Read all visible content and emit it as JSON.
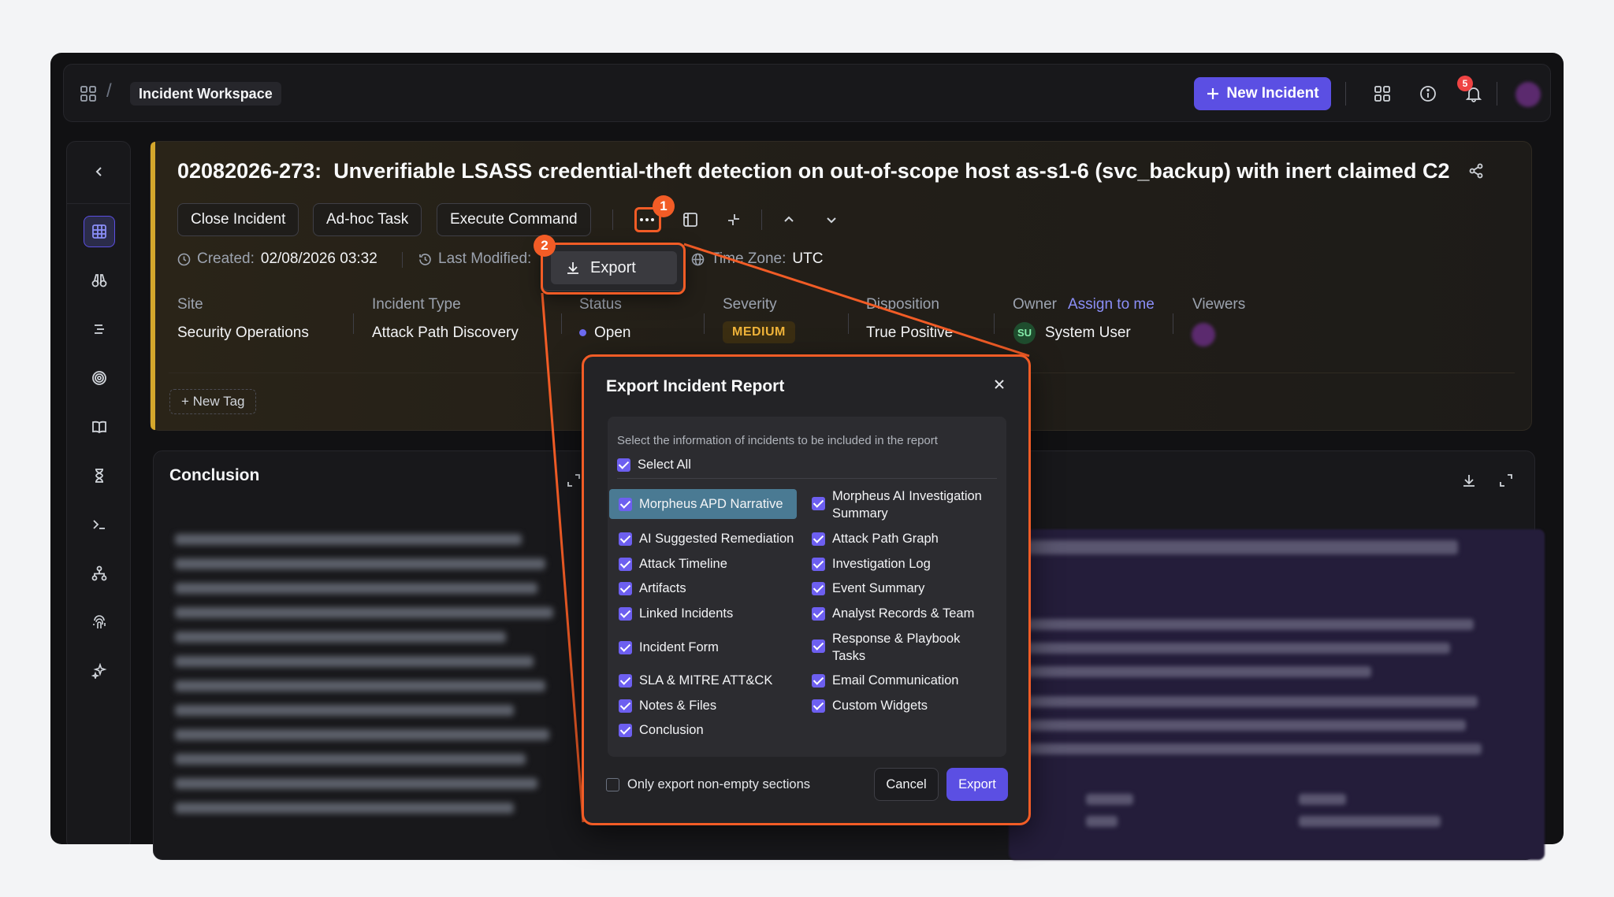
{
  "topbar": {
    "breadcrumb": "Incident Workspace",
    "new_incident_label": "New Incident",
    "notification_count": "5"
  },
  "incident": {
    "id": "02082026-273:",
    "title": "Unverifiable LSASS credential-theft detection on out-of-scope host as-s1-6 (svc_backup) with inert claimed C2",
    "actions": {
      "close": "Close Incident",
      "adhoc": "Ad-hoc Task",
      "execute": "Execute Command"
    },
    "meta": {
      "created_label": "Created:",
      "created_value": "02/08/2026 03:32",
      "modified_label": "Last Modified:",
      "timezone_label": "Time Zone:",
      "timezone_value": "UTC"
    },
    "fields": {
      "site_label": "Site",
      "site_value": "Security Operations",
      "type_label": "Incident Type",
      "type_value": "Attack Path Discovery",
      "status_label": "Status",
      "status_value": "Open",
      "severity_label": "Severity",
      "severity_value": "MEDIUM",
      "disposition_label": "Disposition",
      "disposition_value": "True Positive",
      "owner_label": "Owner",
      "assign_label": "Assign to me",
      "owner_initials": "SU",
      "owner_value": "System User",
      "viewers_label": "Viewers"
    },
    "new_tag": "+ New Tag"
  },
  "conclusion": {
    "title": "Conclusion"
  },
  "dropdown": {
    "export_label": "Export"
  },
  "modal": {
    "title": "Export Incident Report",
    "hint": "Select the information of incidents to be included in the report",
    "select_all": "Select All",
    "left_options": [
      "Morpheus APD Narrative",
      "AI Suggested Remediation",
      "Attack Timeline",
      "Artifacts",
      "Linked Incidents",
      "Incident Form",
      "SLA & MITRE ATT&CK",
      "Notes & Files",
      "Conclusion"
    ],
    "right_options": [
      "Morpheus AI Investigation Summary",
      "Attack Path Graph",
      "Investigation Log",
      "Event Summary",
      "Analyst Records & Team",
      "Response & Playbook Tasks",
      "Email Communication",
      "Custom Widgets"
    ],
    "non_empty_label": "Only export non-empty sections",
    "cancel_label": "Cancel",
    "export_label": "Export"
  },
  "annotations": {
    "step1": "1",
    "step2": "2"
  },
  "colors": {
    "accent": "#5b4fe3",
    "highlight": "#f25c26",
    "severity": "#f0b43a"
  }
}
